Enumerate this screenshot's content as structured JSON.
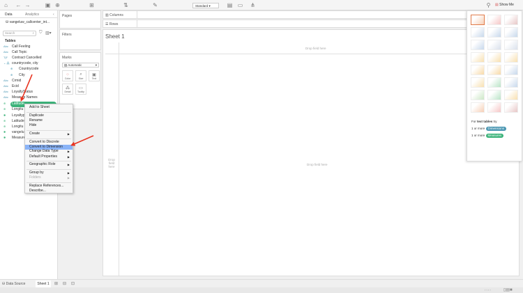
{
  "toolbar": {
    "mark_size": "Standard",
    "show_me_label": "Show Me"
  },
  "datapane": {
    "tab_data": "Data",
    "tab_analytics": "Analytics",
    "datasource": "vangeluw_callcenter_int...",
    "search_placeholder": "Search",
    "tables_label": "Tables",
    "fields": [
      {
        "icon": "Abc",
        "name": "Call Feeling"
      },
      {
        "icon": "Abc",
        "name": "Call Topic"
      },
      {
        "icon": "T|F",
        "name": "Contract Cancelled"
      },
      {
        "icon": "hier",
        "name": "countrycode, city"
      },
      {
        "icon": "geo",
        "name": "Countrycode"
      },
      {
        "icon": "geo",
        "name": "City"
      },
      {
        "icon": "Abc",
        "name": "Crmid"
      },
      {
        "icon": "Abc",
        "name": "Ecid"
      },
      {
        "icon": "Abc",
        "name": "LoyaltyStatus"
      },
      {
        "icon": "Abc",
        "name": "Measure Names"
      },
      {
        "icon": "geo",
        "name": "Latitude"
      },
      {
        "icon": "geo",
        "name": "Longitu"
      },
      {
        "icon": "#",
        "name": "Loyaltyp"
      },
      {
        "icon": "geo",
        "name": "Latitude"
      },
      {
        "icon": "geo",
        "name": "Longitu"
      },
      {
        "icon": "#",
        "name": "vangelu"
      },
      {
        "icon": "#",
        "name": "Measure"
      }
    ]
  },
  "shelves": {
    "pages": "Pages",
    "filters": "Filters",
    "marks": "Marks",
    "mark_type": "Automatic",
    "columns": "Columns",
    "rows": "Rows",
    "mark_buttons": [
      "Color",
      "Size",
      "Text",
      "Detail",
      "Tooltip"
    ]
  },
  "view": {
    "sheet_title": "Sheet 1",
    "drop_top": "Drop field here",
    "drop_left": "Drop field here",
    "drop_center": "Drop field here"
  },
  "menu": [
    "Add to Sheet",
    "Duplicate",
    "Rename",
    "Hide",
    "Create",
    "Convert to Discrete",
    "Convert to Dimension",
    "Change Data Type",
    "Default Properties",
    "Geographic Role",
    "Group by",
    "Folders",
    "Replace References...",
    "Describe..."
  ],
  "showme": {
    "for_text": "For",
    "chart_name": "text tables",
    "try": "try",
    "req1": "1 or more",
    "pill1": "Dimensions",
    "req2": "1 or more",
    "pill2": "Measures"
  },
  "bottom": {
    "data_source": "Data Source",
    "sheet_tab": "Sheet 1"
  },
  "colors": {
    "dimension": "#4996b2",
    "measure": "#3cb37a",
    "highlight": "#8ab4f8",
    "arrow": "#e8321e"
  }
}
